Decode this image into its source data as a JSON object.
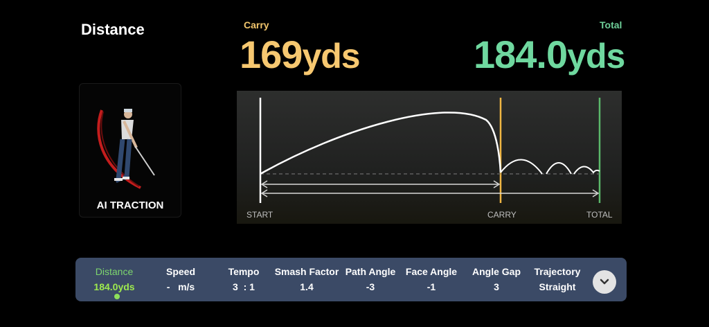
{
  "header": {
    "title": "Distance",
    "carry_label": "Carry",
    "carry_value": "169",
    "carry_unit": "yds",
    "total_label": "Total",
    "total_value": "184.0",
    "total_unit": "yds"
  },
  "ai_card": {
    "label": "AI TRACTION"
  },
  "graph": {
    "start_label": "START",
    "carry_label": "CARRY",
    "total_label": "TOTAL"
  },
  "stats": [
    {
      "label": "Distance",
      "value": "184.0yds",
      "active": true
    },
    {
      "label": "Speed",
      "value": "-   m/s"
    },
    {
      "label": "Tempo",
      "value": "3  : 1"
    },
    {
      "label": "Smash Factor",
      "value": "1.4"
    },
    {
      "label": "Path Angle",
      "value": "-3"
    },
    {
      "label": "Face Angle",
      "value": "-1"
    },
    {
      "label": "Angle Gap",
      "value": "3"
    },
    {
      "label": "Trajectory",
      "value": "Straight"
    }
  ],
  "expand_icon": "chevron-down-icon",
  "colors": {
    "carry": "#f7c870",
    "total": "#6fd89f",
    "active": "#9eea4e",
    "bar": "#3b4a66"
  }
}
